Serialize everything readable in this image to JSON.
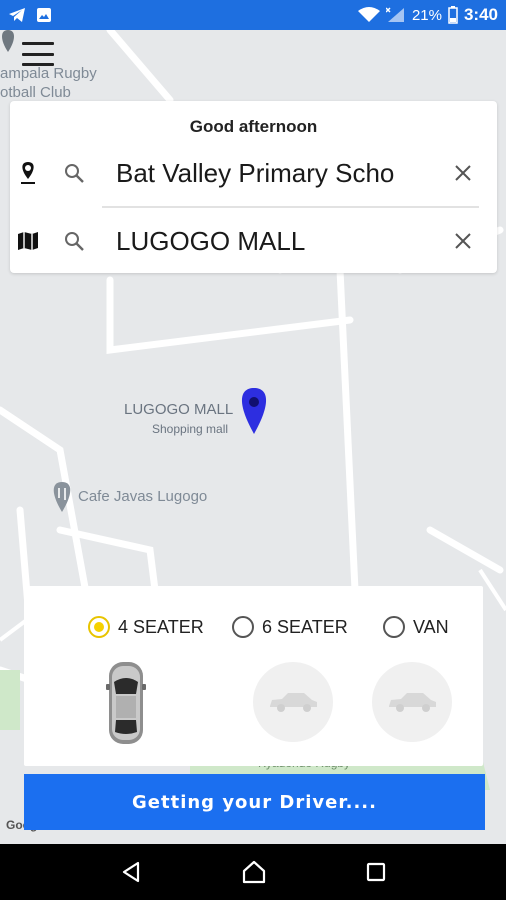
{
  "status_bar": {
    "battery_percent": "21%",
    "time": "3:40",
    "icons": [
      "telegram-icon",
      "image-icon",
      "wifi-icon",
      "signal-icon",
      "battery-icon"
    ]
  },
  "map": {
    "labels": {
      "rugby_club_line1": "ampala Rugby",
      "rugby_club_line2": "otball Club",
      "lugogo_mall": "LUGOGO MALL",
      "lugogo_sub": "Shopping mall",
      "cafe": "Cafe Javas Lugogo",
      "kyadondo": "Kyadondo Rugby",
      "google": "Google"
    },
    "marker_color": "#2d2ee0"
  },
  "search": {
    "greeting": "Good afternoon",
    "pickup": "Bat Valley Primary Scho",
    "destination": "LUGOGO MALL"
  },
  "vehicles": {
    "options": [
      {
        "label": "4 SEATER",
        "selected": true
      },
      {
        "label": "6 SEATER",
        "selected": false
      },
      {
        "label": "VAN",
        "selected": false
      }
    ]
  },
  "action": {
    "label": "Getting your Driver...."
  },
  "colors": {
    "accent": "#1b6ff0",
    "status_bar": "#1e6fe0",
    "radio_selected": "#f5d100"
  }
}
